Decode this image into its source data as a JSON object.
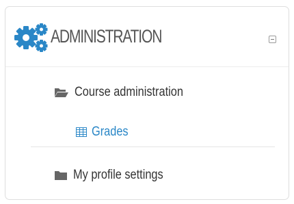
{
  "block": {
    "title": "ADMINISTRATION",
    "header_icon": "gears-icon",
    "collapse_icon": "minus-square-icon"
  },
  "nav": {
    "course_admin": {
      "label": "Course administration",
      "icon": "folder-open-icon"
    },
    "grades": {
      "label": "Grades",
      "icon": "table-grid-icon"
    },
    "profile_settings": {
      "label": "My profile settings",
      "icon": "folder-icon"
    }
  },
  "colors": {
    "accent": "#2a87c7",
    "title": "#555555",
    "text": "#333333",
    "icon": "#666666"
  }
}
